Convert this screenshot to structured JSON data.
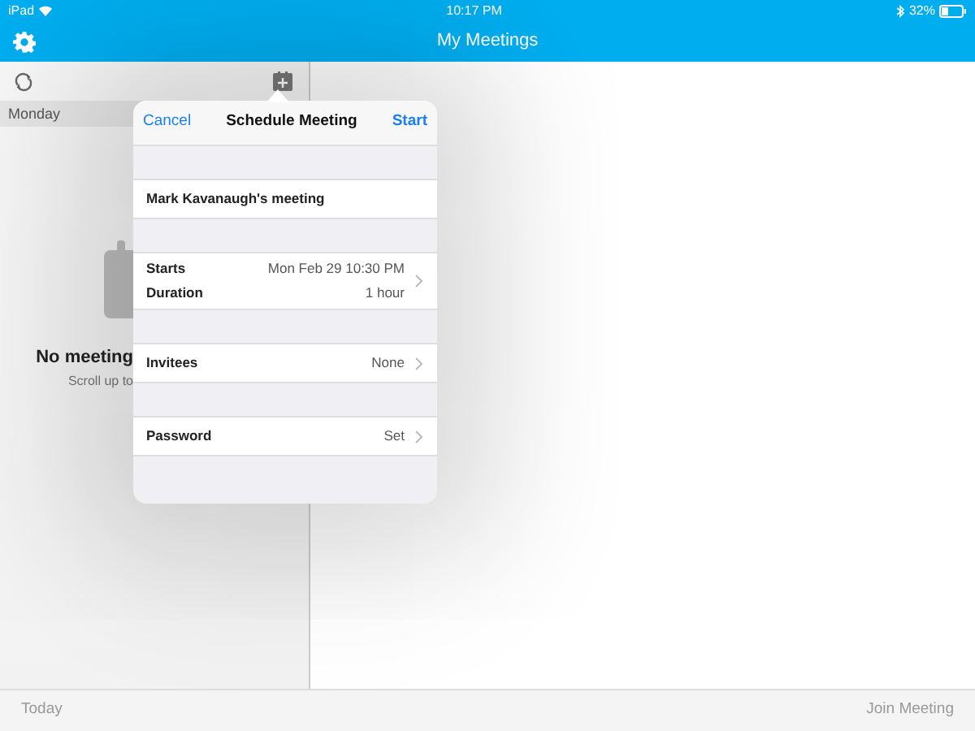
{
  "status_bar": {
    "device": "iPad",
    "time": "10:17 PM",
    "battery": "32%"
  },
  "nav_bar": {
    "title": "My Meetings"
  },
  "sidebar": {
    "section": "Monday",
    "empty_title": "No meeting",
    "empty_hint": "Scroll up to"
  },
  "popover": {
    "cancel": "Cancel",
    "title": "Schedule Meeting",
    "start": "Start",
    "rows": [
      {
        "kind": "name",
        "label": "Mark Kavanaugh's meeting"
      },
      {
        "kind": "double",
        "label": "Starts",
        "value": "Mon Feb 29 10:30 PM",
        "label_2": "Duration",
        "value_2": "1 hour"
      },
      {
        "kind": "detail",
        "label": "Invitees",
        "value": "None"
      },
      {
        "kind": "detail",
        "label": "Password",
        "value": "Set"
      }
    ]
  },
  "bottom_bar": {
    "left": "Today",
    "right": "Join Meeting"
  }
}
